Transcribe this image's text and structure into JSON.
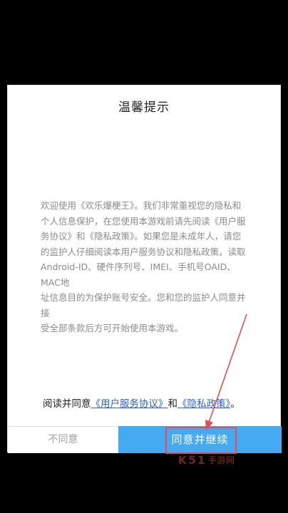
{
  "dialog": {
    "title": "温馨提示",
    "body": "欢迎使用《欢乐爆梗王》。我们非常重视您的隐私和\n个人信息保护，在您使用本游戏前请先阅读《用户服\n务协议》和《隐私政策》。如果您是未成年人，请您\n的监护人仔细阅读本用户服务协议和隐私政策。读取\nAndroid-ID、硬件序列号、IMEI、手机号OAID、MAC地\n址信息目的为保护账号安全。您和您的监护人同意并接\n受全部条款后方可开始使用本游戏。",
    "consent": {
      "prefix": "阅读并同意",
      "link1": "《用户服务协议》",
      "middle": "和",
      "link2": "《隐私政策》",
      "suffix": "。"
    },
    "buttons": {
      "disagree": "不同意",
      "agree": "同意并继续"
    }
  },
  "watermark": {
    "text": "手游网"
  },
  "colors": {
    "agree_button": "#46aaf3",
    "link": "#2c5fd6",
    "annotation": "#e44d54"
  }
}
